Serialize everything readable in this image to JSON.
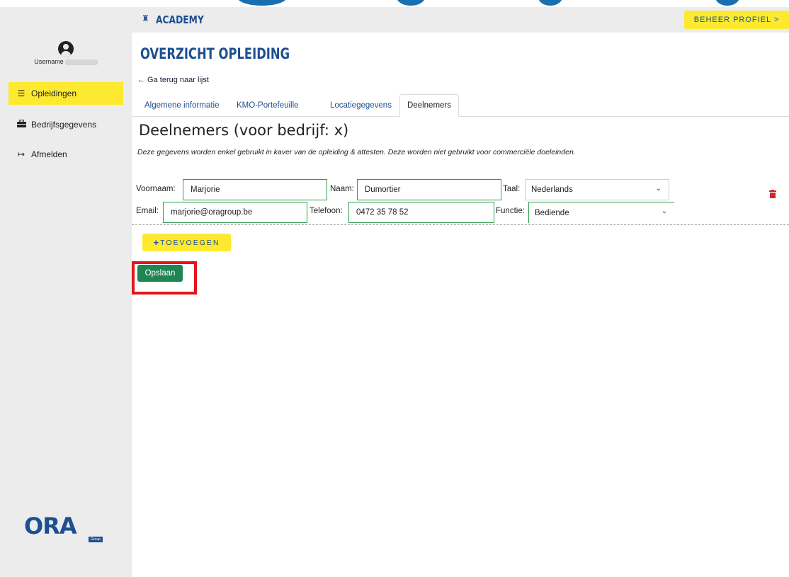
{
  "header": {
    "app_title": "ACADEMY",
    "profile_button": "BEHEER PROFIEL >"
  },
  "sidebar": {
    "username_label": "Username",
    "items": [
      {
        "label": "Opleidingen",
        "icon": "list-icon",
        "active": true
      },
      {
        "label": "Bedrijfsgegevens",
        "icon": "briefcase-icon",
        "active": false
      },
      {
        "label": "Afmelden",
        "icon": "sign-out-icon",
        "active": false
      }
    ],
    "logo_text": "ORA",
    "logo_sub": "Group"
  },
  "main": {
    "page_title": "OVERZICHT OPLEIDING",
    "back_link": "← Ga terug naar lijst",
    "tabs": [
      {
        "label": "Algemene informatie",
        "active": false
      },
      {
        "label": "KMO-Portefeuille",
        "active": false
      },
      {
        "label": "Locatiegegevens",
        "active": false
      },
      {
        "label": "Deelnemers",
        "active": true
      }
    ],
    "section_title": "Deelnemers (voor bedrijf: x)",
    "section_subtitle": "Deze gegevens worden enkel gebruikt in kaver van de opleiding & attesten. Deze worden niet gebruikt voor commerciële doeleinden."
  },
  "participant": {
    "voornaam_label": "Voornaam:",
    "voornaam_value": "Marjorie",
    "naam_label": "Naam:",
    "naam_value": "Dumortier",
    "taal_label": "Taal:",
    "taal_value": "Nederlands",
    "email_label": "Email:",
    "email_value": "marjorie@oragroup.be",
    "telefoon_label": "Telefoon:",
    "telefoon_value": "0472 35 78 52",
    "functie_label": "Functie:",
    "functie_value": "Bediende"
  },
  "actions": {
    "add_label": "TOEVOEGEN",
    "save_label": "Opslaan"
  },
  "colors": {
    "brand_blue": "#1d4f91",
    "accent_yellow": "#fde92f",
    "save_green": "#1f8552",
    "field_border_green": "#2e9e4f",
    "highlight_red": "#e3151b",
    "delete_red": "#d9232a"
  }
}
